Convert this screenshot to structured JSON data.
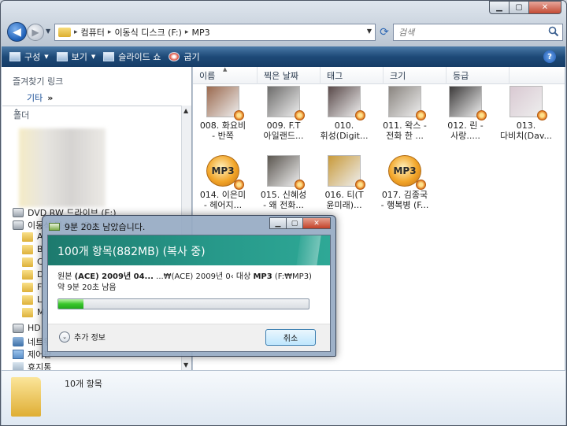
{
  "window": {
    "minimize_glyph": "▁",
    "maximize_glyph": "▢",
    "close_glyph": "✕"
  },
  "address_bar": {
    "breadcrumbs": [
      "컴퓨터",
      "이동식 디스크 (F:)",
      "MP3"
    ],
    "separator": "▸",
    "search_placeholder": "검색"
  },
  "toolbar": {
    "items": [
      {
        "label": "구성",
        "icon": "organize-icon",
        "has_menu": true
      },
      {
        "label": "보기",
        "icon": "views-icon",
        "has_menu": true
      },
      {
        "label": "슬라이드 쇼",
        "icon": "slideshow-icon",
        "has_menu": false
      },
      {
        "label": "굽기",
        "icon": "burn-icon",
        "has_menu": false
      }
    ],
    "help_label": "?"
  },
  "left_pane": {
    "favorites_title": "즐겨찾기 링크",
    "favorites_more": "기타",
    "favorites_more_chevron": "»",
    "folders_title": "폴더",
    "tree": [
      {
        "label": "DVD RW 드라이브 (E:)",
        "icon": "dvd-drive-icon"
      },
      {
        "label": "이동식 디스크 (F:)",
        "icon": "removable-disk-icon"
      },
      {
        "label": "A",
        "icon": "folder-icon"
      },
      {
        "label": "B",
        "icon": "folder-icon"
      },
      {
        "label": "C",
        "icon": "folder-icon"
      },
      {
        "label": "D",
        "icon": "folder-icon"
      },
      {
        "label": "F",
        "icon": "folder-icon"
      },
      {
        "label": "L",
        "icon": "folder-icon"
      },
      {
        "label": "M",
        "icon": "folder-icon"
      },
      {
        "label": "HD",
        "icon": "drive-icon"
      },
      {
        "label": "네트워크",
        "icon": "network-icon"
      },
      {
        "label": "제어판",
        "icon": "control-panel-icon"
      },
      {
        "label": "휴지통",
        "icon": "recycle-bin-icon"
      }
    ]
  },
  "columns": [
    "이름",
    "찍은 날짜",
    "태그",
    "크기",
    "등급"
  ],
  "files": [
    {
      "line1": "008. 화요비",
      "line2": "- 반쪽",
      "type": "photo",
      "color": "#9b6a4f"
    },
    {
      "line1": "009. F.T",
      "line2": "아일랜드...",
      "type": "photo",
      "color": "#6d6c6b"
    },
    {
      "line1": "010.",
      "line2": "휘성(Digit...",
      "type": "photo",
      "color": "#5a4a4a"
    },
    {
      "line1": "011. 왁스 -",
      "line2": "전화 한 ...",
      "type": "photo",
      "color": "#8a8580"
    },
    {
      "line1": "012. 린 -",
      "line2": "사랑.....",
      "type": "photo",
      "color": "#3c3a3a"
    },
    {
      "line1": "013.",
      "line2": "다비치(Dav...",
      "type": "photo",
      "color": "#d9c9d2"
    },
    {
      "line1": "014. 이은미",
      "line2": "- 헤어지...",
      "type": "mp3",
      "color": "#f2a62a"
    },
    {
      "line1": "015. 신혜성",
      "line2": "- 왜 전화...",
      "type": "photo",
      "color": "#5b5650"
    },
    {
      "line1": "016. 티(T",
      "line2": "윤미래)...",
      "type": "photo",
      "color": "#c89a3a"
    },
    {
      "line1": "017. 김종국",
      "line2": "- 행복병 (F...",
      "type": "mp3",
      "color": "#f2a62a"
    }
  ],
  "mp3_label": "MP3",
  "details": {
    "count": "10개 항목"
  },
  "copy_dialog": {
    "title": "9분 20초 남았습니다.",
    "header": "100개 항목(882MB) (복사 중)",
    "source_label": "원본",
    "source_value": "(ACE) 2009년 04...",
    "path_text": "...₩(ACE) 2009년 0‹ 대상",
    "dest_label": "MP3",
    "dest_path": "(F:₩MP3)",
    "remaining": "약 9분 20초 남음",
    "progress": 0.1,
    "more_info": "추가 정보",
    "more_info_glyph": "⌄",
    "cancel": "취소",
    "progress_color": "#3ac72c"
  }
}
